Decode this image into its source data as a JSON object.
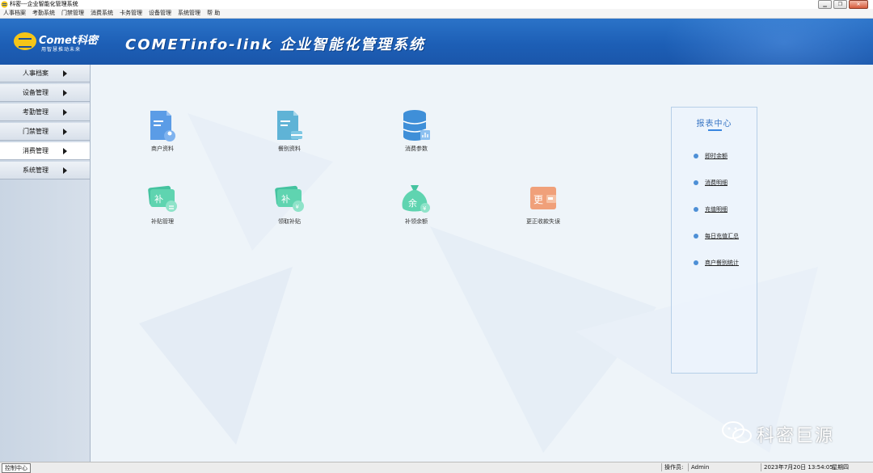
{
  "window": {
    "title": "科密---企业智能化管理系统",
    "controls": [
      "minimize",
      "restore",
      "close"
    ]
  },
  "menu": [
    "人事档案",
    "考勤系统",
    "门禁管理",
    "消费系统",
    "卡务管理",
    "设备管理",
    "系统管理",
    "帮 助"
  ],
  "banner": {
    "logo_brand": "Comet科密",
    "logo_slogan": "用智慧推动未来",
    "system_title": "COMETinfo-link 企业智能化管理系统",
    "colors": {
      "top": "#2b73c8",
      "bottom": "#1a56aa",
      "logo_badge": "#f5c518"
    }
  },
  "sidebar": {
    "items": [
      {
        "label": "人事档案",
        "active": false
      },
      {
        "label": "设备管理",
        "active": false
      },
      {
        "label": "考勤管理",
        "active": false
      },
      {
        "label": "门禁管理",
        "active": false
      },
      {
        "label": "消费管理",
        "active": true
      },
      {
        "label": "系统管理",
        "active": false
      }
    ]
  },
  "tiles": [
    {
      "label": "商户资料",
      "icon": "document-icon",
      "color": "#5b9ce6"
    },
    {
      "label": "餐别资料",
      "icon": "document-icon",
      "color": "#5fb3d6"
    },
    {
      "label": "消费参数",
      "icon": "database-icon",
      "color": "#3f8fd8"
    },
    {
      "label": "补贴管理",
      "icon": "subsidy-icon",
      "color": "#45c3a0"
    },
    {
      "label": "领取补贴",
      "icon": "subsidy-icon",
      "color": "#45c3a0"
    },
    {
      "label": "补领余额",
      "icon": "money-bag-icon",
      "color": "#45c3a0"
    },
    {
      "label": "更正收款失误",
      "icon": "correction-icon",
      "color": "#f0a07a"
    }
  ],
  "report_center": {
    "title": "报表中心",
    "links": [
      "即时余额",
      "消费明细",
      "充值明细",
      "每日充值汇总",
      "商户餐别统计"
    ]
  },
  "watermark": {
    "text": "科密巨源"
  },
  "statusbar": {
    "tab": "控制中心",
    "operator_label": "操作员:",
    "operator": "Admin",
    "datetime": "2023年7月20日 13:54:05",
    "weekday": "星期四"
  }
}
